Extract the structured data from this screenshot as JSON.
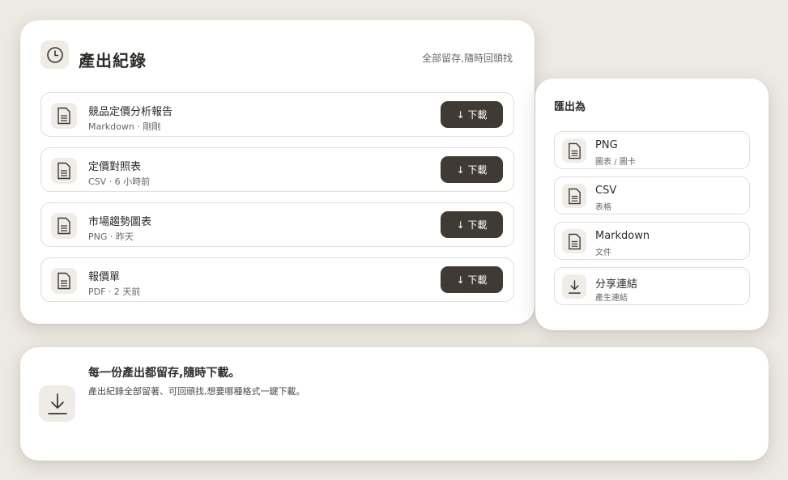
{
  "history": {
    "icon": "clock-icon",
    "title": "產出紀錄",
    "note": "全部留存,隨時回頭找",
    "items": [
      {
        "title": "競品定價分析報告",
        "sub": "Markdown · 剛剛",
        "button": "↓ 下載"
      },
      {
        "title": "定價對照表",
        "sub": "CSV · 6 小時前",
        "button": "↓ 下載"
      },
      {
        "title": "市場趨勢圖表",
        "sub": "PNG · 昨天",
        "button": "↓ 下載"
      },
      {
        "title": "報價單",
        "sub": "PDF · 2 天前",
        "button": "↓ 下載"
      }
    ]
  },
  "export": {
    "title": "匯出為",
    "options": [
      {
        "label": "PNG",
        "sub": "圖表 / 圖卡",
        "icon": "file-icon"
      },
      {
        "label": "CSV",
        "sub": "表格",
        "icon": "file-icon"
      },
      {
        "label": "Markdown",
        "sub": "文件",
        "icon": "file-icon"
      },
      {
        "label": "分享連結",
        "sub": "產生連結",
        "icon": "download-icon"
      }
    ]
  },
  "banner": {
    "icon": "download-icon",
    "title": "每一份產出都留存,隨時下載。",
    "desc": "產出紀錄全部留著、可回頭找,想要哪種格式一鍵下載。"
  },
  "colors": {
    "background": "#ede9e3",
    "button": "#403a35",
    "icon_bg": "#efebe6"
  }
}
